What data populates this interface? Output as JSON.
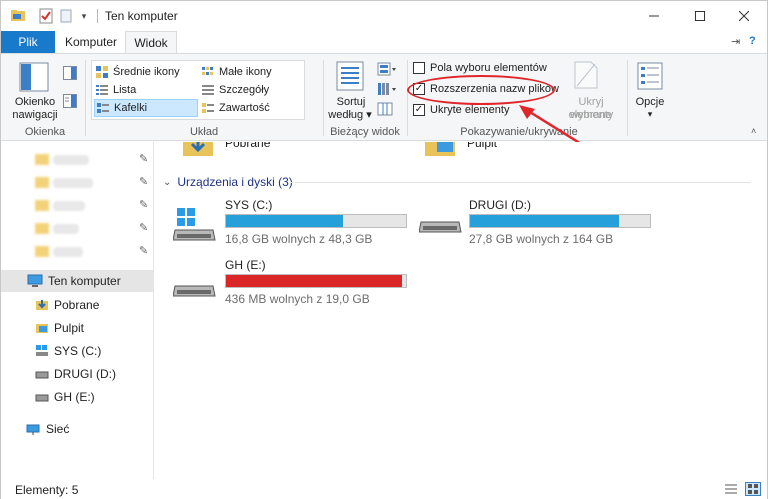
{
  "window": {
    "title": "Ten komputer"
  },
  "tabs": {
    "file": "Plik",
    "computer": "Komputer",
    "view": "Widok"
  },
  "ribbon": {
    "panes": {
      "nav_pane_label_1": "Okienko",
      "nav_pane_label_2": "nawigacji",
      "group": "Okienka"
    },
    "layout": {
      "items": [
        "Średnie ikony",
        "Małe ikony",
        "Lista",
        "Szczegóły",
        "Kafelki",
        "Zawartość"
      ],
      "selected": "Kafelki",
      "group": "Układ"
    },
    "current_view": {
      "sort_label_1": "Sortuj",
      "sort_label_2": "według",
      "group": "Bieżący widok"
    },
    "show_hide": {
      "item_checkboxes": "Pola wyboru elementów",
      "item_checkboxes_checked": false,
      "file_extensions": "Rozszerzenia nazw plików",
      "file_extensions_checked": true,
      "hidden_items": "Ukryte elementy",
      "hidden_items_checked": true,
      "hide_selected_1": "Ukryj wybrane",
      "hide_selected_2": "elementy",
      "group": "Pokazywanie/ukrywanie"
    },
    "options": {
      "label": "Opcje"
    }
  },
  "nav": {
    "this_pc": "Ten komputer",
    "items": [
      "Pobrane",
      "Pulpit",
      "SYS (C:)",
      "DRUGI (D:)",
      "GH (E:)"
    ],
    "network": "Sieć"
  },
  "content": {
    "top_folders": [
      "Pobrane",
      "Pulpit"
    ],
    "section_title": "Urządzenia i dyski (3)",
    "drives": [
      {
        "name": "SYS (C:)",
        "free": "16,8 GB wolnych z 48,3 GB",
        "used_fraction": 0.65,
        "color": "#26a0da"
      },
      {
        "name": "DRUGI (D:)",
        "free": "27,8 GB wolnych z 164 GB",
        "used_fraction": 0.83,
        "color": "#26a0da"
      },
      {
        "name": "GH (E:)",
        "free": "436 MB wolnych z 19,0 GB",
        "used_fraction": 0.98,
        "color": "#da2626"
      }
    ]
  },
  "status": {
    "items_count": "Elementy: 5"
  },
  "colors": {
    "accent": "#1979ca",
    "annotation": "#e0252b"
  }
}
